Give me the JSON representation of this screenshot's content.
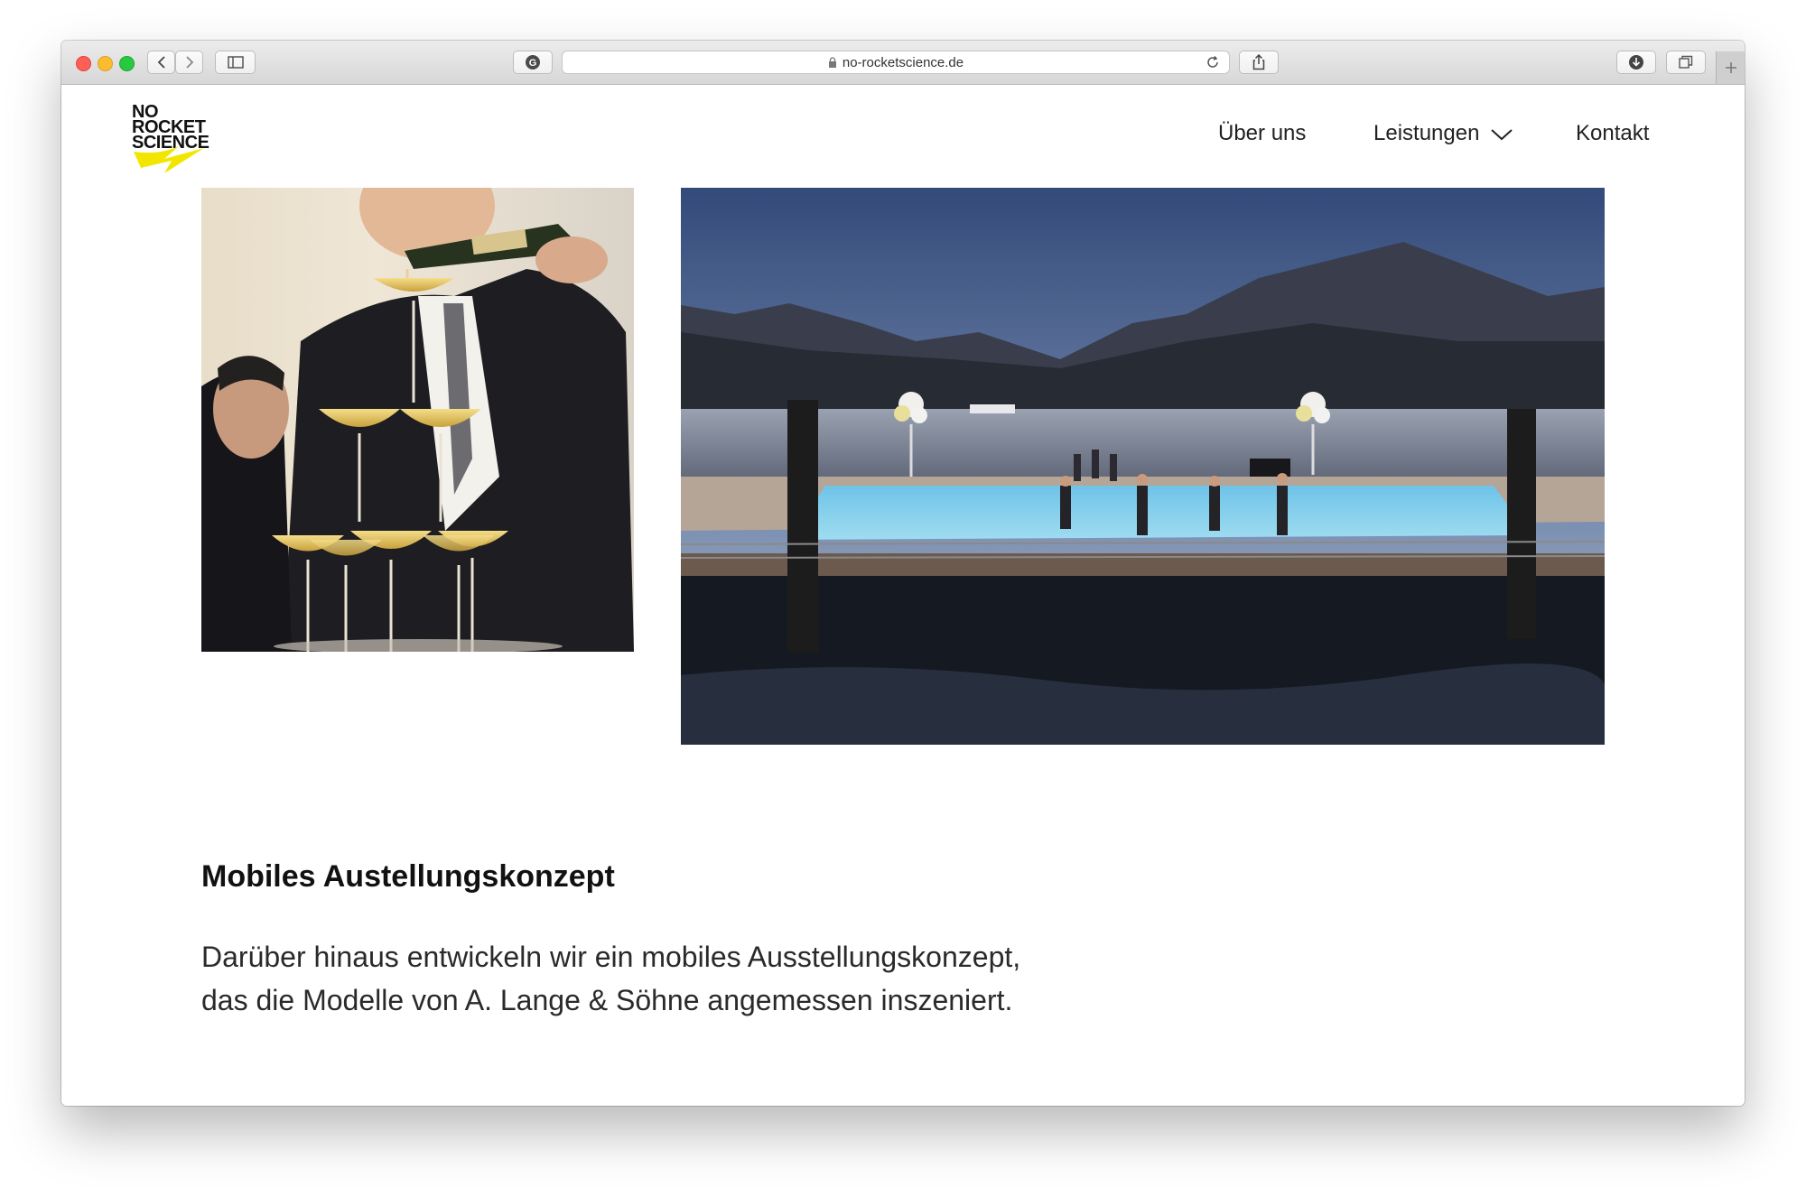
{
  "browser": {
    "url": "no-rocketscience.de"
  },
  "site": {
    "logo_lines": [
      "NO",
      "ROCKET",
      "SCIENCE"
    ],
    "nav": {
      "ueber": "Über uns",
      "leistungen": "Leistungen",
      "kontakt": "Kontakt"
    }
  },
  "section": {
    "heading": "Mobiles Austellungskonzept",
    "paragraph_line1": "Darüber hinaus entwickeln wir ein mobiles Ausstellungskonzept,",
    "paragraph_line2": "das die Modelle von A. Lange & Söhne angemessen inszeniert."
  },
  "colors": {
    "accent_yellow": "#f2e600",
    "text": "#111111"
  }
}
